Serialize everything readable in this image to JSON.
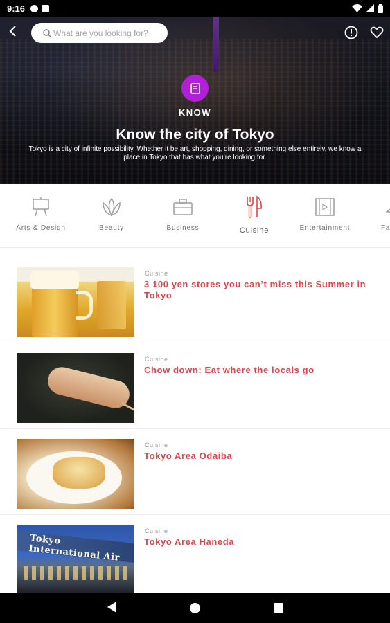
{
  "status_bar": {
    "time": "9:16"
  },
  "search": {
    "placeholder": "What are you looking for?"
  },
  "hero": {
    "section": "KNOW",
    "title": "Know the city of Tokyo",
    "description": "Tokyo is a city of infinite possibility. Whether it be art, shopping, dining, or something else entirely, we know a place in Tokyo that has what you’re looking for."
  },
  "categories": [
    {
      "label": "Arts & Design",
      "icon": "easel-icon"
    },
    {
      "label": "Beauty",
      "icon": "lotus-icon"
    },
    {
      "label": "Business",
      "icon": "briefcase-icon"
    },
    {
      "label": "Cuisine",
      "icon": "fork-knife-icon",
      "active": true
    },
    {
      "label": "Entertainment",
      "icon": "film-icon"
    },
    {
      "label": "Fa",
      "icon": "hanger-icon"
    }
  ],
  "articles": [
    {
      "category": "Cuisine",
      "title": "3 100 yen stores you can’t miss this Summer in Tokyo"
    },
    {
      "category": "Cuisine",
      "title": "Chow down: Eat where the locals go"
    },
    {
      "category": "Cuisine",
      "title": "Tokyo Area Odaiba"
    },
    {
      "category": "Cuisine",
      "title": "Tokyo Area Haneda"
    }
  ],
  "thumb_text": {
    "airport_sign": "Tokyo International Air"
  },
  "colors": {
    "accent": "#e8404a",
    "badge": "#b21fd9",
    "active_icon": "#e8404a",
    "inactive_icon": "#9e9e9e"
  }
}
